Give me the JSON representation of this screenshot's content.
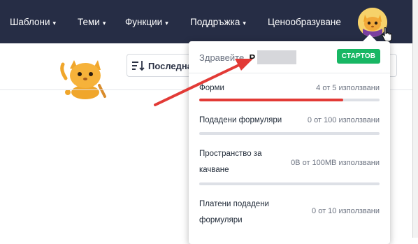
{
  "nav": {
    "items": [
      {
        "label": "Шаблони",
        "caret": "▾"
      },
      {
        "label": "Теми",
        "caret": "▾"
      },
      {
        "label": "Функции",
        "caret": "▾"
      },
      {
        "label": "Поддръжка",
        "caret": "▾"
      },
      {
        "label": "Ценообразуване",
        "caret": ""
      }
    ],
    "avatar_icon": "cat-avatar-icon"
  },
  "toolbar": {
    "sort_label": "Последна",
    "sort_icon": "sort-descending-icon"
  },
  "account_menu": {
    "greeting": "Здравейте,",
    "user_initial": "Р",
    "plan_badge": "СТАРТОВ",
    "usage": [
      {
        "label": "Форми",
        "value": "4 от 5 използвани",
        "fraction": 0.8
      },
      {
        "label": "Подадени формуляри",
        "value": "0 от 100 използвани",
        "fraction": 0
      },
      {
        "label": "Пространство за качване",
        "value": "0B от 100MB използвани",
        "fraction": 0
      },
      {
        "label": "Платени подадени формуляри",
        "value": "0 от 10 използвани",
        "fraction": 0
      }
    ]
  },
  "colors": {
    "topbar": "#262d45",
    "badge": "#18b764",
    "usage_fill": "#e23a36",
    "arrow": "#e23a36"
  }
}
